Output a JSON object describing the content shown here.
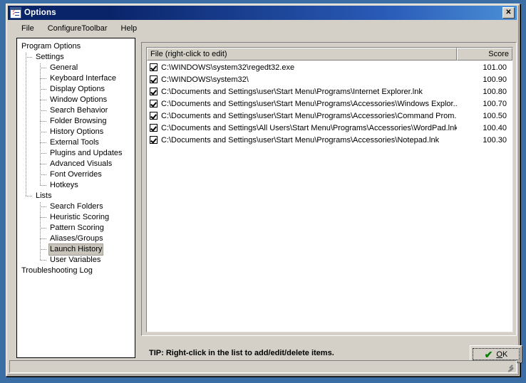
{
  "window": {
    "title": "Options",
    "icon": "options-checklist-icon",
    "close_label": "✕"
  },
  "menubar": {
    "items": [
      {
        "label": "File",
        "name": "menu-file"
      },
      {
        "label": "ConfigureToolbar",
        "name": "menu-configure-toolbar"
      },
      {
        "label": "Help",
        "name": "menu-help"
      }
    ]
  },
  "tree": {
    "selected": "Launch History",
    "items": [
      {
        "label": "Program Options",
        "level": 0
      },
      {
        "label": "Settings",
        "level": 1
      },
      {
        "label": "General",
        "level": 2
      },
      {
        "label": "Keyboard Interface",
        "level": 2
      },
      {
        "label": "Display Options",
        "level": 2
      },
      {
        "label": "Window Options",
        "level": 2
      },
      {
        "label": "Search Behavior",
        "level": 2
      },
      {
        "label": "Folder Browsing",
        "level": 2
      },
      {
        "label": "History Options",
        "level": 2
      },
      {
        "label": "External Tools",
        "level": 2
      },
      {
        "label": "Plugins and Updates",
        "level": 2
      },
      {
        "label": "Advanced Visuals",
        "level": 2
      },
      {
        "label": "Font Overrides",
        "level": 2
      },
      {
        "label": "Hotkeys",
        "level": 2
      },
      {
        "label": "Lists",
        "level": 1
      },
      {
        "label": "Search Folders",
        "level": 2
      },
      {
        "label": "Heuristic Scoring",
        "level": 2
      },
      {
        "label": "Pattern Scoring",
        "level": 2
      },
      {
        "label": "Aliases/Groups",
        "level": 2
      },
      {
        "label": "Launch History",
        "level": 2
      },
      {
        "label": "User Variables",
        "level": 2
      },
      {
        "label": "Troubleshooting Log",
        "level": 0
      }
    ]
  },
  "list": {
    "columns": [
      {
        "label": "File (right-click to edit)",
        "align": "left"
      },
      {
        "label": "Score",
        "align": "right"
      }
    ],
    "rows": [
      {
        "checked": true,
        "file": "C:\\WINDOWS\\system32\\regedt32.exe",
        "score": "101.00"
      },
      {
        "checked": true,
        "file": "C:\\WINDOWS\\system32\\",
        "score": "100.90"
      },
      {
        "checked": true,
        "file": "C:\\Documents and Settings\\user\\Start Menu\\Programs\\Internet Explorer.lnk",
        "score": "100.80"
      },
      {
        "checked": true,
        "file": "C:\\Documents and Settings\\user\\Start Menu\\Programs\\Accessories\\Windows Explor...",
        "score": "100.70"
      },
      {
        "checked": true,
        "file": "C:\\Documents and Settings\\user\\Start Menu\\Programs\\Accessories\\Command Prom...",
        "score": "100.50"
      },
      {
        "checked": true,
        "file": "C:\\Documents and Settings\\All Users\\Start Menu\\Programs\\Accessories\\WordPad.lnk",
        "score": "100.40"
      },
      {
        "checked": true,
        "file": "C:\\Documents and Settings\\user\\Start Menu\\Programs\\Accessories\\Notepad.lnk",
        "score": "100.30"
      }
    ]
  },
  "footer": {
    "tip": "TIP: Right-click in the list to add/edit/delete items.",
    "ok_prefix": "O",
    "ok_suffix": "K",
    "ok_check": "✔"
  },
  "statusbar": {
    "text": ""
  },
  "colors": {
    "desktop": "#3a6ea5",
    "face": "#d4d0c8",
    "title_start": "#0a246a",
    "title_end": "#4b8fd6",
    "selection": "#c8c4bc",
    "ok_check": "#008000"
  }
}
